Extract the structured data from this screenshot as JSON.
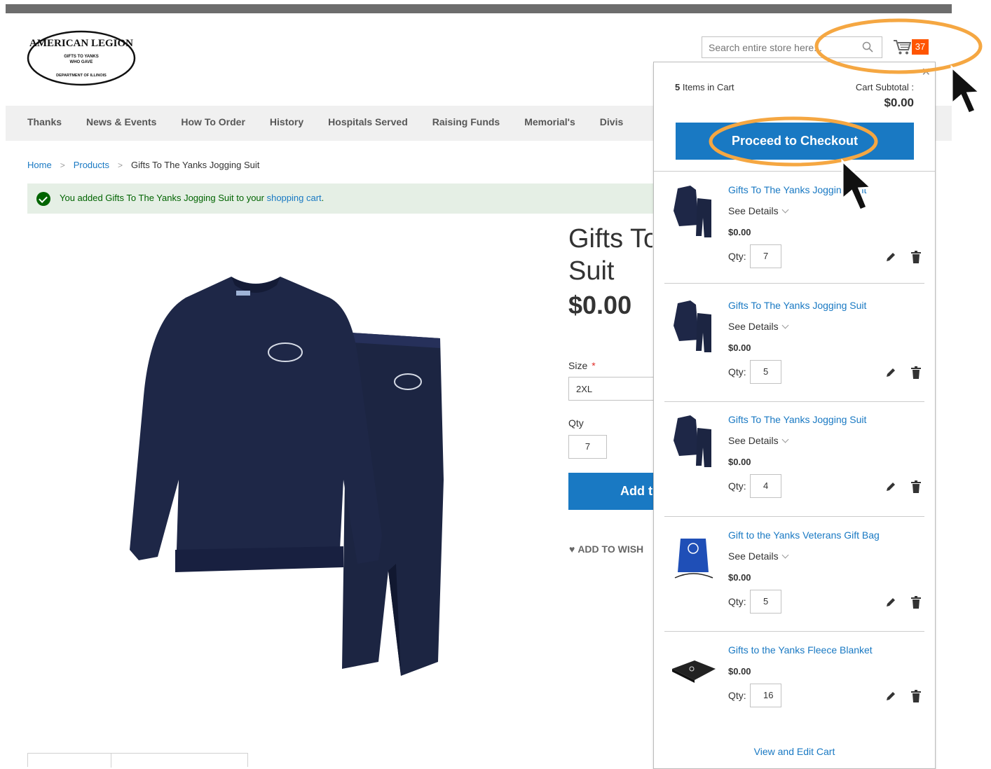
{
  "header": {
    "logo": {
      "line1": "AMERICAN LEGION",
      "line2": "GIFTS TO YANKS",
      "line3": "WHO GAVE",
      "line4": "DEPARTMENT OF ILLINOIS"
    },
    "search_placeholder": "Search entire store here...",
    "cart_count": "37"
  },
  "nav": {
    "items": [
      "Thanks",
      "News & Events",
      "How To Order",
      "History",
      "Hospitals Served",
      "Raising Funds",
      "Memorial's",
      "Divis"
    ]
  },
  "breadcrumb": {
    "home": "Home",
    "products": "Products",
    "current": "Gifts To The Yanks Jogging Suit"
  },
  "message": {
    "before": "You added Gifts To The Yanks Jogging Suit to your ",
    "link": "shopping cart",
    "after": "."
  },
  "product": {
    "title_line1": "Gifts To",
    "title_line2": "Suit",
    "price": "$0.00",
    "size_label": "Size",
    "size_required": "*",
    "size_value": "2XL",
    "qty_label": "Qty",
    "qty_value": "7",
    "add_button": "Add t",
    "wishlist": "ADD TO WISH"
  },
  "minicart": {
    "count": "5",
    "count_suffix": " Items in Cart",
    "subtotal_label": "Cart Subtotal :",
    "subtotal": "$0.00",
    "checkout": "Proceed to Checkout",
    "see_details": "See Details",
    "qty_label": "Qty:",
    "items": [
      {
        "name": "Gifts To The Yanks Jogging Suit",
        "price": "$0.00",
        "qty": "7",
        "details": true
      },
      {
        "name": "Gifts To The Yanks Jogging Suit",
        "price": "$0.00",
        "qty": "5",
        "details": true
      },
      {
        "name": "Gifts To The Yanks Jogging Suit",
        "price": "$0.00",
        "qty": "4",
        "details": true
      },
      {
        "name": "Gift to the Yanks Veterans Gift Bag",
        "price": "$0.00",
        "qty": "5",
        "details": true
      },
      {
        "name": "Gifts to the Yanks Fleece Blanket",
        "price": "$0.00",
        "qty": "16",
        "details": false
      }
    ],
    "view_edit": "View and Edit Cart"
  },
  "colors": {
    "accent": "#1979c3",
    "badge": "#ff5501",
    "highlight": "#f5a742",
    "success_bg": "#e5efe5"
  }
}
